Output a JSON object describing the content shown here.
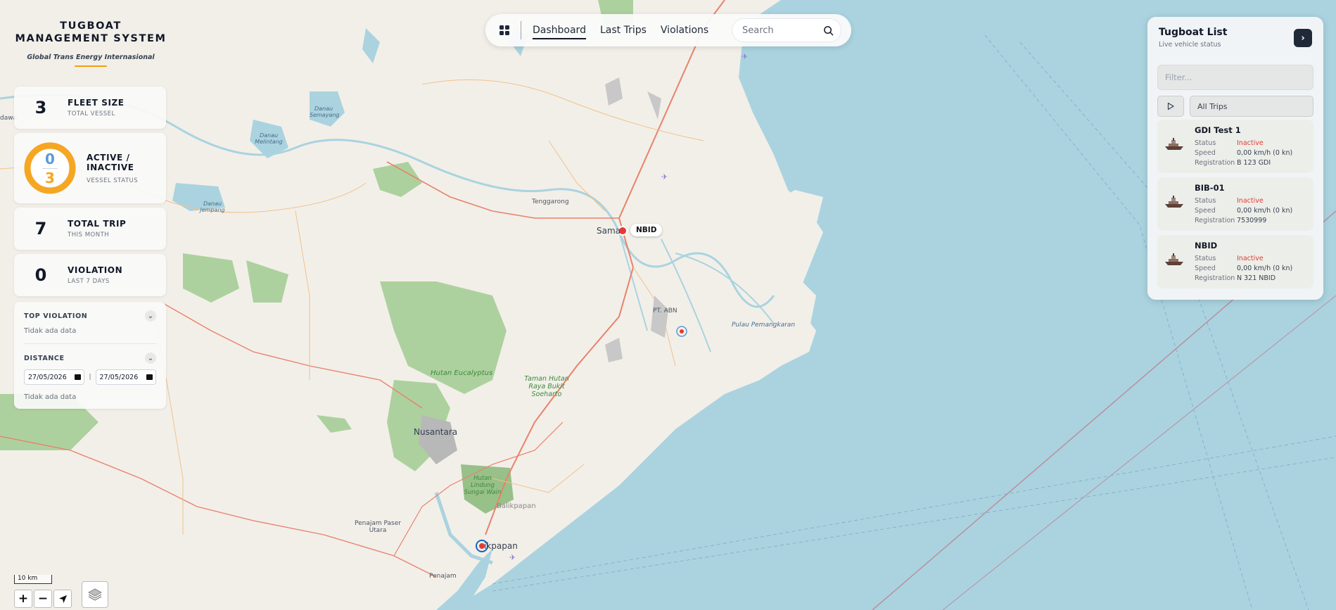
{
  "brand": {
    "title": "TUGBOAT MANAGEMENT SYSTEM",
    "subtitle": "Global Trans Energy Internasional"
  },
  "stats": {
    "fleet": {
      "value": "3",
      "label": "FLEET SIZE",
      "sub": "TOTAL VESSEL"
    },
    "status": {
      "active": "0",
      "inactive": "3",
      "label": "ACTIVE / INACTIVE",
      "sub": "VESSEL STATUS",
      "active_color": "#5b9bd5",
      "inactive_color": "#f5a623"
    },
    "trip": {
      "value": "7",
      "label": "TOTAL TRIP",
      "sub": "THIS MONTH"
    },
    "violation": {
      "value": "0",
      "label": "VIOLATION",
      "sub": "LAST 7 DAYS"
    }
  },
  "filters": {
    "top_violation": {
      "title": "TOP VIOLATION",
      "empty": "Tidak ada data"
    },
    "distance": {
      "title": "DISTANCE",
      "from": "27/05/2026",
      "to": "27/05/2026",
      "separator": "|",
      "empty": "Tidak ada data"
    }
  },
  "nav": {
    "tabs": [
      {
        "label": "Dashboard",
        "active": true
      },
      {
        "label": "Last Trips",
        "active": false
      },
      {
        "label": "Violations",
        "active": false
      }
    ],
    "search_placeholder": "Search"
  },
  "panel": {
    "title": "Tugboat List",
    "subtitle": "Live vehicle status",
    "filter_placeholder": "Filter...",
    "trip_select": "All Trips",
    "field_labels": {
      "status": "Status",
      "speed": "Speed",
      "registration": "Registration"
    },
    "boats": [
      {
        "name": "GDI Test 1",
        "status": "Inactive",
        "speed": "0,00 km/h (0 kn)",
        "registration": "B 123 GDI"
      },
      {
        "name": "BIB-01",
        "status": "Inactive",
        "speed": "0,00 km/h (0 kn)",
        "registration": "7530999"
      },
      {
        "name": "NBID",
        "status": "Inactive",
        "speed": "0,00 km/h (0 kn)",
        "registration": "N 321 NBID"
      }
    ]
  },
  "map": {
    "marker_label": "NBID",
    "scale": "10 km",
    "places": {
      "tenggarong": "Tenggarong",
      "samarinda": "Sama",
      "pt_abn": "PT. ABN",
      "pulau": "Pulau Pemangkaran",
      "hutan_eucalyptus": "Hutan Eucalyptus",
      "taman": "Taman Hutan Raya Bukit Soeharto",
      "nusantara": "Nusantara",
      "hutan_lindung": "Hutan Lindung Sungai Wain",
      "balikpapan_1": "Balikpapan",
      "balikpapan_2": "ikpapan",
      "penajam_paser": "Penajam Paser Utara",
      "penajam": "Penajam",
      "danau_semayang": "Danau Semayang",
      "danau_melintang": "Danau Melintang",
      "danau_jempang": "Danau Jempang",
      "dawa": "dawa"
    },
    "colors": {
      "sea": "#aad3df",
      "land": "#f2efe9",
      "forest": "#add19e",
      "road_major": "#e8826b",
      "road_minor": "#f0c28a",
      "water": "#aad3df"
    }
  }
}
